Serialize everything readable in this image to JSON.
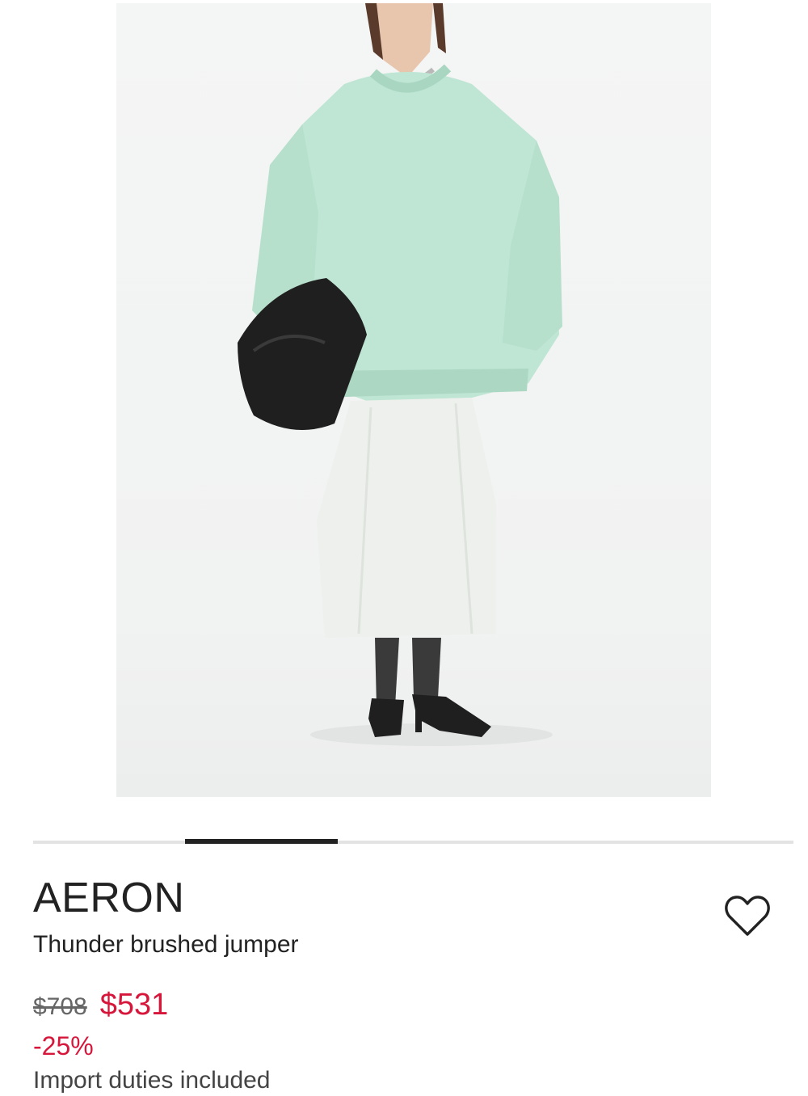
{
  "product": {
    "image_alt": "Model wearing mint green brushed jumper with white midi skirt",
    "brand": "AERON",
    "name": "Thunder brushed jumper",
    "price_original": "$708",
    "price_sale": "$531",
    "discount": "-25%",
    "import_note": "Import duties included"
  },
  "gallery": {
    "slide_count": 5,
    "current_slide": 2
  },
  "icons": {
    "wishlist": "heart-outline-icon"
  },
  "colors": {
    "sale": "#d6163a",
    "text": "#222222",
    "track": "#e3e3e3"
  }
}
